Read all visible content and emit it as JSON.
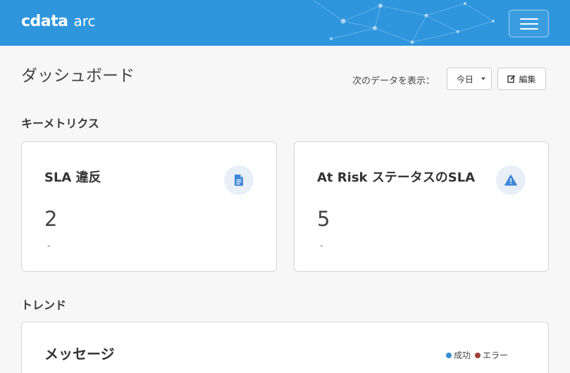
{
  "header": {
    "logo_text": "cdata",
    "logo_suffix": "arc",
    "menu_icon": "hamburger-menu-icon",
    "color": "#2f96dd"
  },
  "page": {
    "title": "ダッシュボード",
    "show_label": "次のデータを表示：",
    "range_value": "今日",
    "edit_label": "編集",
    "edit_icon": "edit-icon"
  },
  "sections": {
    "key_metrics": "キーメトリクス",
    "trends": "トレンド"
  },
  "cards": [
    {
      "title": "SLA 違反",
      "value": "2",
      "sub": "-",
      "icon": "document-icon"
    },
    {
      "title": "At Risk ステータスのSLA",
      "value": "5",
      "sub": "-",
      "icon": "warning-icon"
    }
  ],
  "trend_card": {
    "title": "メッセージ",
    "legend": [
      {
        "label": "成功",
        "color": "#3a8fd4"
      },
      {
        "label": "エラー",
        "color": "#a0403d"
      }
    ]
  }
}
